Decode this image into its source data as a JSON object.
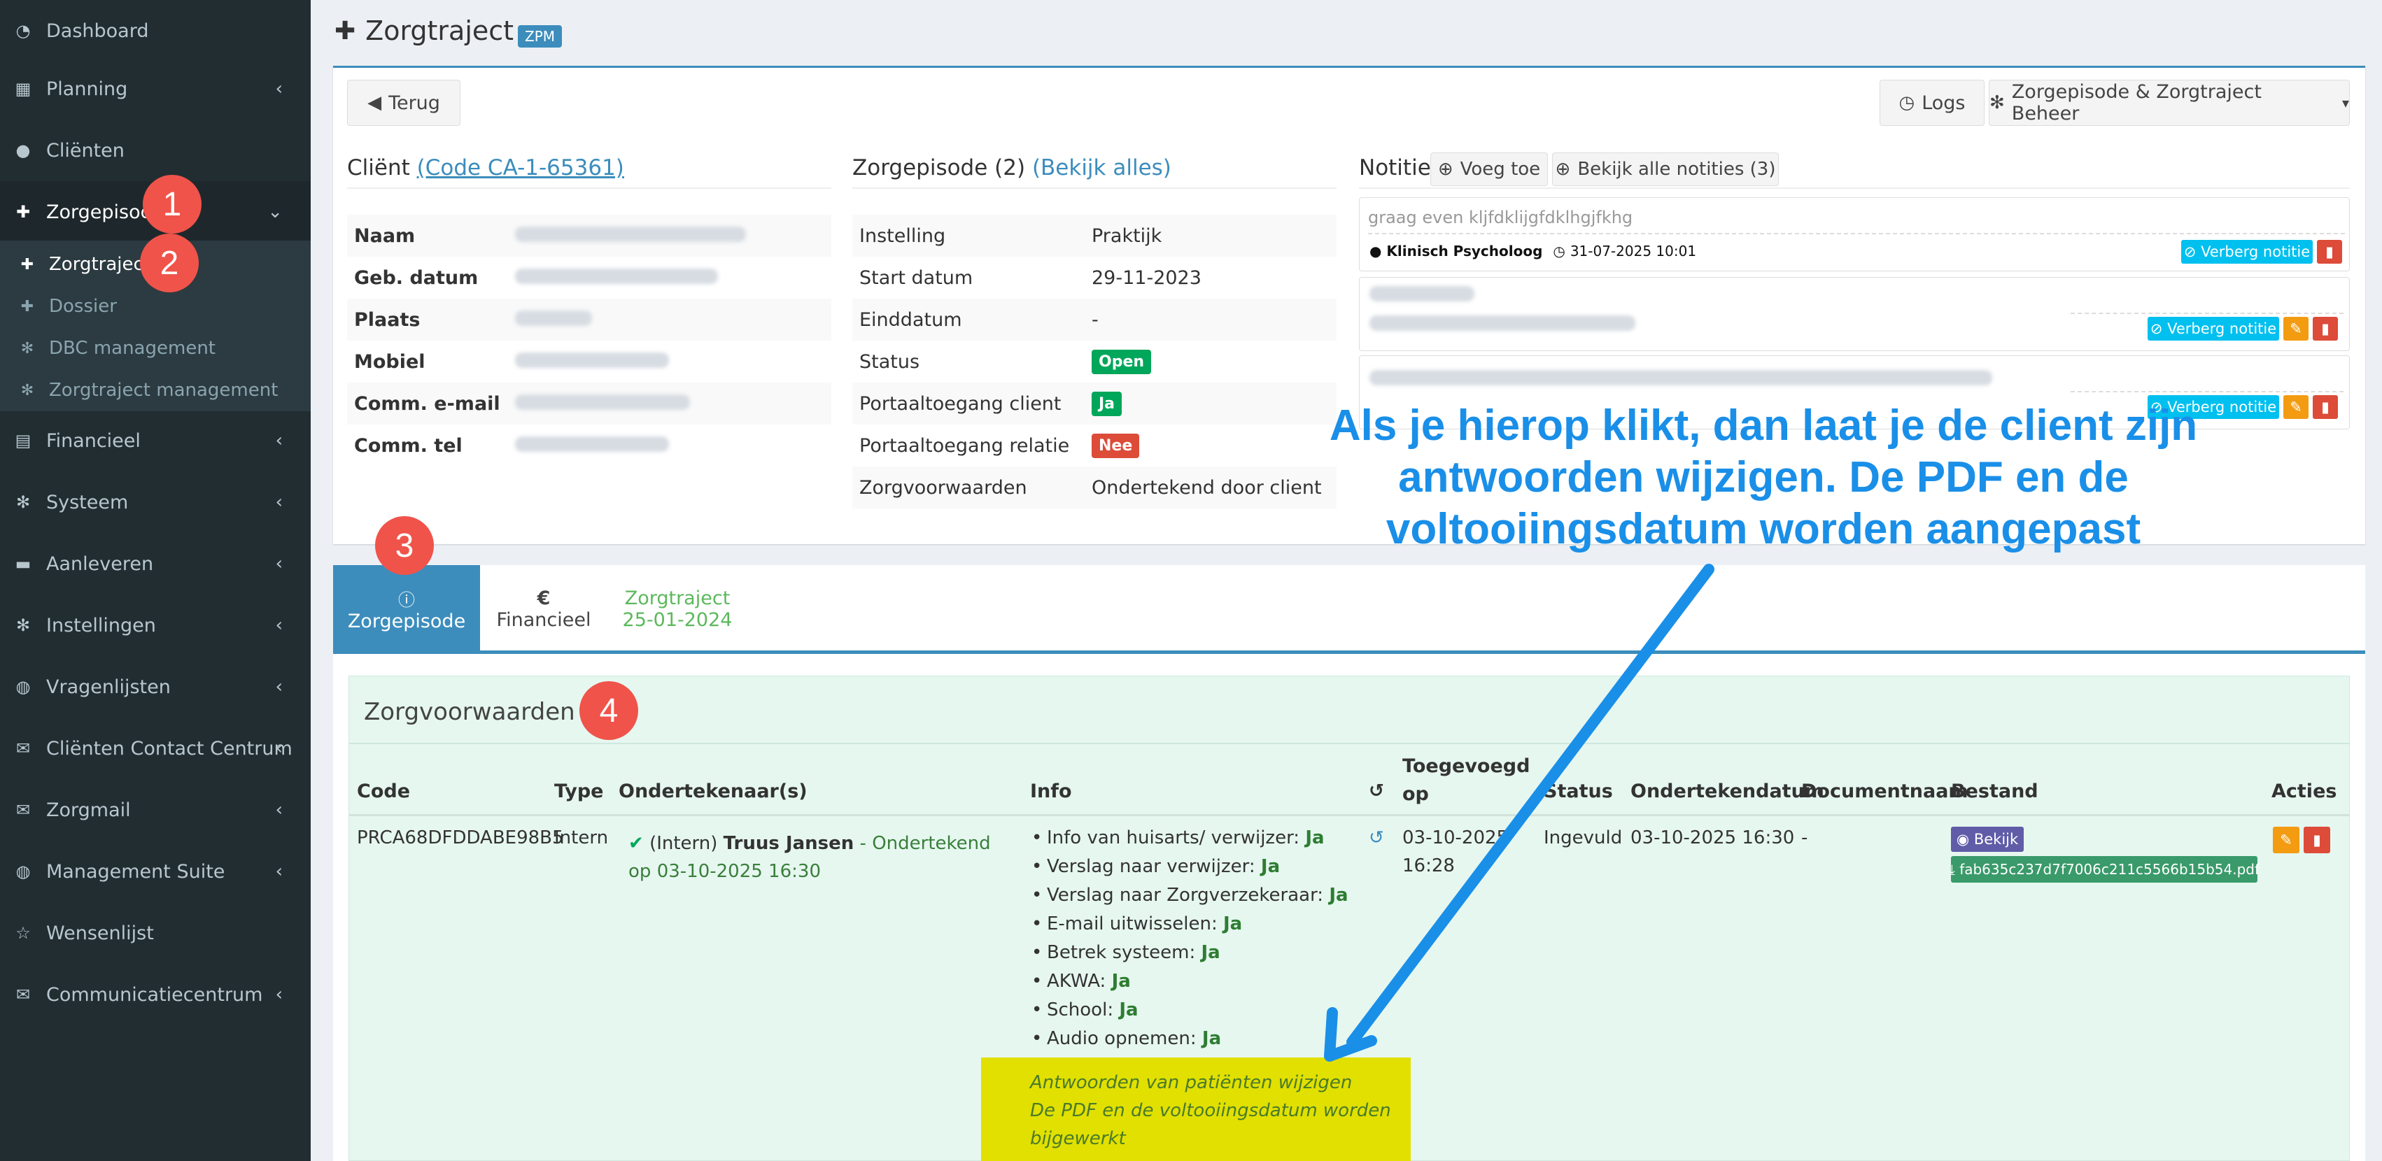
{
  "sidebar": {
    "items": [
      {
        "label": "Dashboard",
        "icon": "dashboard-icon"
      },
      {
        "label": "Planning",
        "icon": "calendar-icon"
      },
      {
        "label": "Cliënten",
        "icon": "user-icon"
      },
      {
        "label": "Zorgepisode",
        "icon": "medkit-icon"
      },
      {
        "label": "Financieel",
        "icon": "book-icon"
      },
      {
        "label": "Systeem",
        "icon": "cogs-icon"
      },
      {
        "label": "Aanleveren",
        "icon": "truck-icon"
      },
      {
        "label": "Instellingen",
        "icon": "gear-icon"
      },
      {
        "label": "Vragenlijsten",
        "icon": "globe-icon"
      },
      {
        "label": "Cliënten Contact Centrum",
        "icon": "envelope-icon"
      },
      {
        "label": "Zorgmail",
        "icon": "envelope-icon"
      },
      {
        "label": "Management Suite",
        "icon": "globe-icon"
      },
      {
        "label": "Wensenlijst",
        "icon": "star-icon"
      },
      {
        "label": "Communicatiecentrum",
        "icon": "envelope-icon"
      }
    ],
    "sub_items": [
      {
        "label": "Zorgtraject"
      },
      {
        "label": "Dossier"
      },
      {
        "label": "DBC management"
      },
      {
        "label": "Zorgtraject management"
      }
    ]
  },
  "badges": {
    "one": "1",
    "two": "2",
    "three": "3",
    "four": "4"
  },
  "header": {
    "title": "Zorgtraject",
    "tag": "ZPM"
  },
  "toolbar": {
    "back": "Terug",
    "logs": "Logs",
    "manage": "Zorgepisode & Zorgtraject Beheer"
  },
  "client": {
    "heading": "Cliënt",
    "code_link": "(Code CA-1-65361)",
    "rows": [
      {
        "key": "Naam"
      },
      {
        "key": "Geb. datum"
      },
      {
        "key": "Plaats"
      },
      {
        "key": "Mobiel"
      },
      {
        "key": "Comm. e-mail"
      },
      {
        "key": "Comm. tel"
      }
    ]
  },
  "episode": {
    "heading": "Zorgepisode (2)",
    "view_all": "(Bekijk alles)",
    "rows": [
      {
        "key": "Instelling",
        "value": "Praktijk"
      },
      {
        "key": "Start datum",
        "value": "29-11-2023"
      },
      {
        "key": "Einddatum",
        "value": "-"
      },
      {
        "key": "Status",
        "value": "Open"
      },
      {
        "key": "Portaaltoegang client",
        "value": "Ja"
      },
      {
        "key": "Portaaltoegang relatie",
        "value": "Nee"
      },
      {
        "key": "Zorgvoorwaarden",
        "value": "Ondertekend door client"
      }
    ]
  },
  "notes": {
    "heading": "Notitie",
    "add": "Voeg toe",
    "view_all": "Bekijk alle notities (3)",
    "first_text": "graag even kljfdklijgfdklhgjfkhg",
    "first_author": "Klinisch Psycholoog",
    "first_date": "31-07-2025 10:01",
    "hide": "Verberg notitie"
  },
  "annotation": {
    "text": "Als je hierop klikt, dan laat je de client zijn antwoorden wijzigen. De PDF en de voltooiingsdatum worden aangepast",
    "color": "#1a8fe8"
  },
  "tabs": {
    "zorgepisode": "Zorgepisode",
    "financieel": "Financieel",
    "financieel_symbol": "€",
    "zorgtraject": "Zorgtraject",
    "zorgtraject_date": "25-01-2024"
  },
  "conditions": {
    "heading": "Zorgvoorwaarden",
    "columns": {
      "code": "Code",
      "type": "Type",
      "signers": "Ondertekenaar(s)",
      "info": "Info",
      "added_1": "Toegevoegd",
      "added_2": "op",
      "status": "Status",
      "signed_date": "Ondertekendatum",
      "doc_name": "Documentnaam",
      "file": "Bestand",
      "actions": "Acties"
    },
    "row": {
      "code": "PRCA68DFDDABE98B5",
      "type": "Intern",
      "signer_prefix": "(Intern)",
      "signer_name": "Truus Jansen",
      "signer_status": "- Ondertekend op",
      "signer_date": "03-10-2025 16:30",
      "info": [
        {
          "label": "Info van huisarts/ verwijzer:",
          "value": "Ja"
        },
        {
          "label": "Verslag naar verwijzer:",
          "value": "Ja"
        },
        {
          "label": "Verslag naar Zorgverzekeraar:",
          "value": "Ja"
        },
        {
          "label": "E-mail uitwisselen:",
          "value": "Ja"
        },
        {
          "label": "Betrek systeem:",
          "value": "Ja"
        },
        {
          "label": "AKWA:",
          "value": "Ja"
        },
        {
          "label": "School:",
          "value": "Ja"
        },
        {
          "label": "Audio opnemen:",
          "value": "Ja"
        }
      ],
      "added_date": "03-10-2025",
      "added_time": "16:28",
      "status": "Ingevuld",
      "signed_date": "03-10-2025 16:30",
      "doc_name": "-",
      "view": "Bekijk",
      "file": "fab635c237d7f7006c211c5566b15b54.pdf"
    },
    "highlight": {
      "line1": "Antwoorden van patiënten wijzigen",
      "line2": "De PDF en de voltooiingsdatum worden",
      "line3": "bijgewerkt"
    }
  }
}
